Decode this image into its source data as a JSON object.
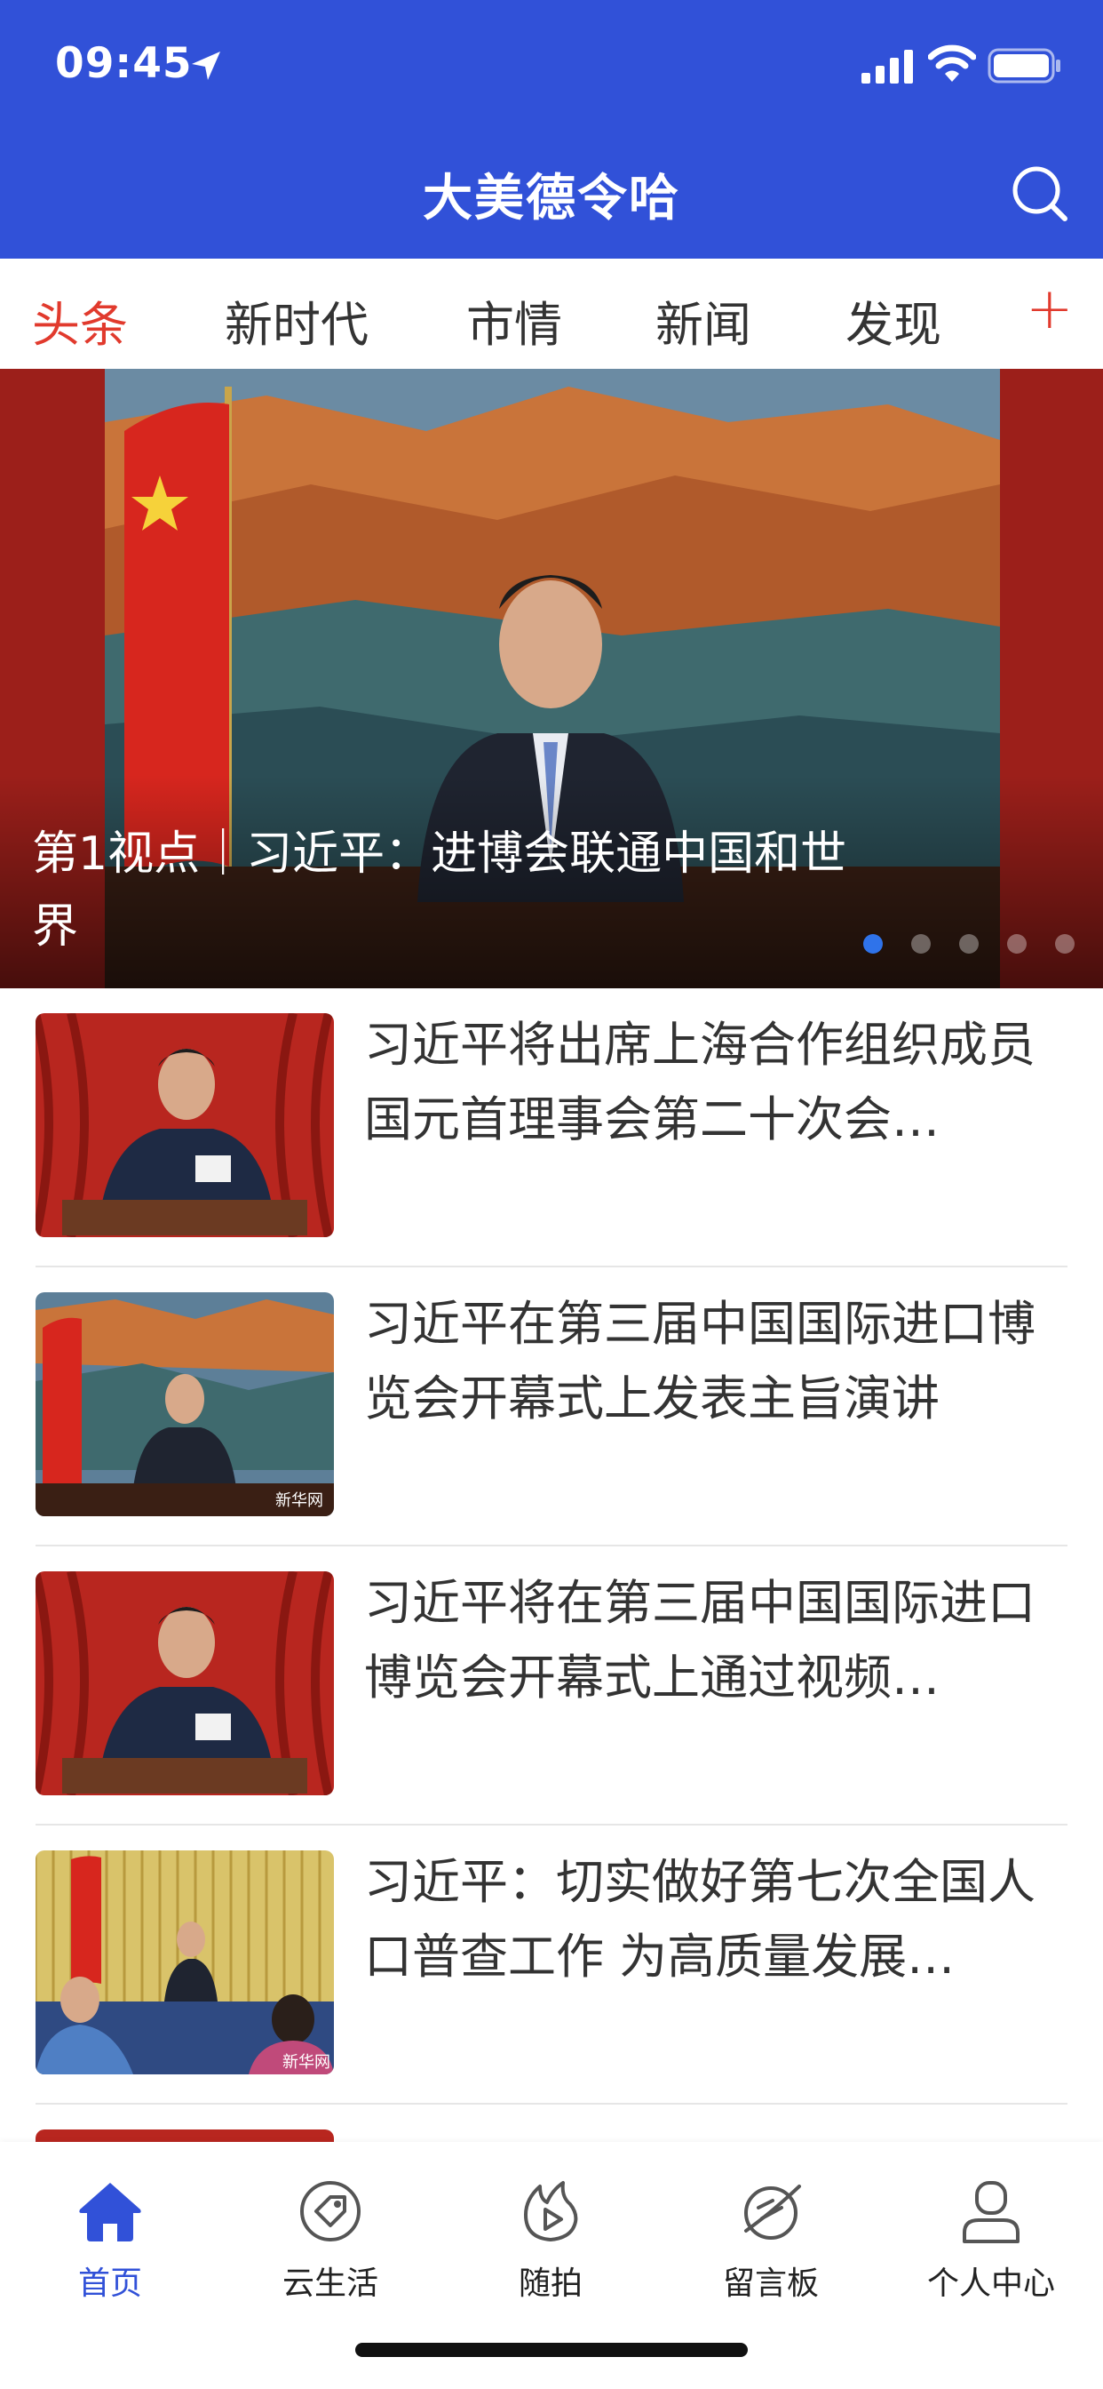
{
  "status_bar": {
    "time": "09:45"
  },
  "header": {
    "title": "大美德令哈"
  },
  "tabs": [
    {
      "label": "头条",
      "active": true
    },
    {
      "label": "新时代",
      "active": false
    },
    {
      "label": "市情",
      "active": false
    },
    {
      "label": "新闻",
      "active": false
    },
    {
      "label": "发现",
      "active": false
    }
  ],
  "tabs_more": "+",
  "banner": {
    "caption": "第1视点｜习近平：进博会联通中国和世界",
    "dot_count": 5,
    "active_dot": 1
  },
  "news": [
    {
      "title": "习近平将出席上海合作组织成员国元首理事会第二十次会…"
    },
    {
      "title": "习近平在第三届中国国际进口博览会开幕式上发表主旨演讲"
    },
    {
      "title": "习近平将在第三届中国国际进口博览会开幕式上通过视频…"
    },
    {
      "title": "习近平：切实做好第七次全国人口普查工作 为高质量发展…"
    }
  ],
  "bottom_nav": [
    {
      "label": "首页",
      "icon": "home-icon",
      "active": true
    },
    {
      "label": "云生活",
      "icon": "tag-icon",
      "active": false
    },
    {
      "label": "随拍",
      "icon": "play-flame-icon",
      "active": false
    },
    {
      "label": "留言板",
      "icon": "message-board-icon",
      "active": false
    },
    {
      "label": "个人中心",
      "icon": "user-icon",
      "active": false
    }
  ],
  "colors": {
    "brand": "#3151d8",
    "accent": "#e13a2d",
    "dot_active": "#2f73ea"
  }
}
